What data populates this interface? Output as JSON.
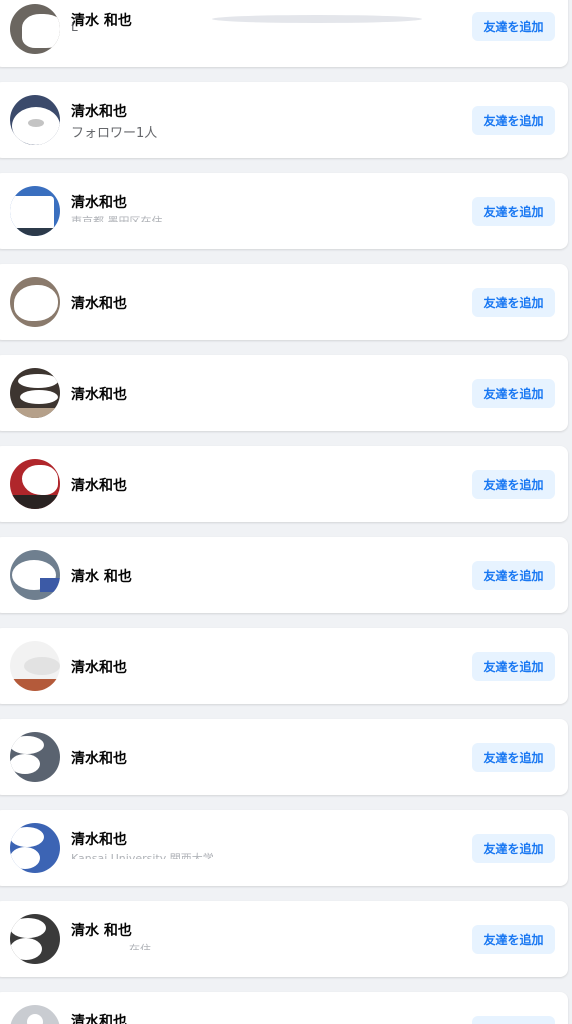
{
  "add_friend_label": "友達を追加",
  "colors": {
    "page_bg": "#f0f2f5",
    "card_bg": "#ffffff",
    "button_bg": "#e7f3ff",
    "button_text": "#1877f2",
    "name_text": "#050505",
    "sub_text": "#65676b"
  },
  "results": [
    {
      "name": "清水 和也",
      "subtitle": "L",
      "subtitle2": ""
    },
    {
      "name": "清水和也",
      "subtitle": "フォロワー1人"
    },
    {
      "name": "清水和也",
      "subtitle": "東京都 墨田区在住"
    },
    {
      "name": "清水和也"
    },
    {
      "name": "清水和也"
    },
    {
      "name": "清水和也"
    },
    {
      "name": "清水 和也"
    },
    {
      "name": "清水和也"
    },
    {
      "name": "清水和也"
    },
    {
      "name": "清水和也",
      "subtitle": "Kansai University 関西大学"
    },
    {
      "name": "清水 和也",
      "subtitle": "在住"
    },
    {
      "name": "清水和也"
    }
  ]
}
